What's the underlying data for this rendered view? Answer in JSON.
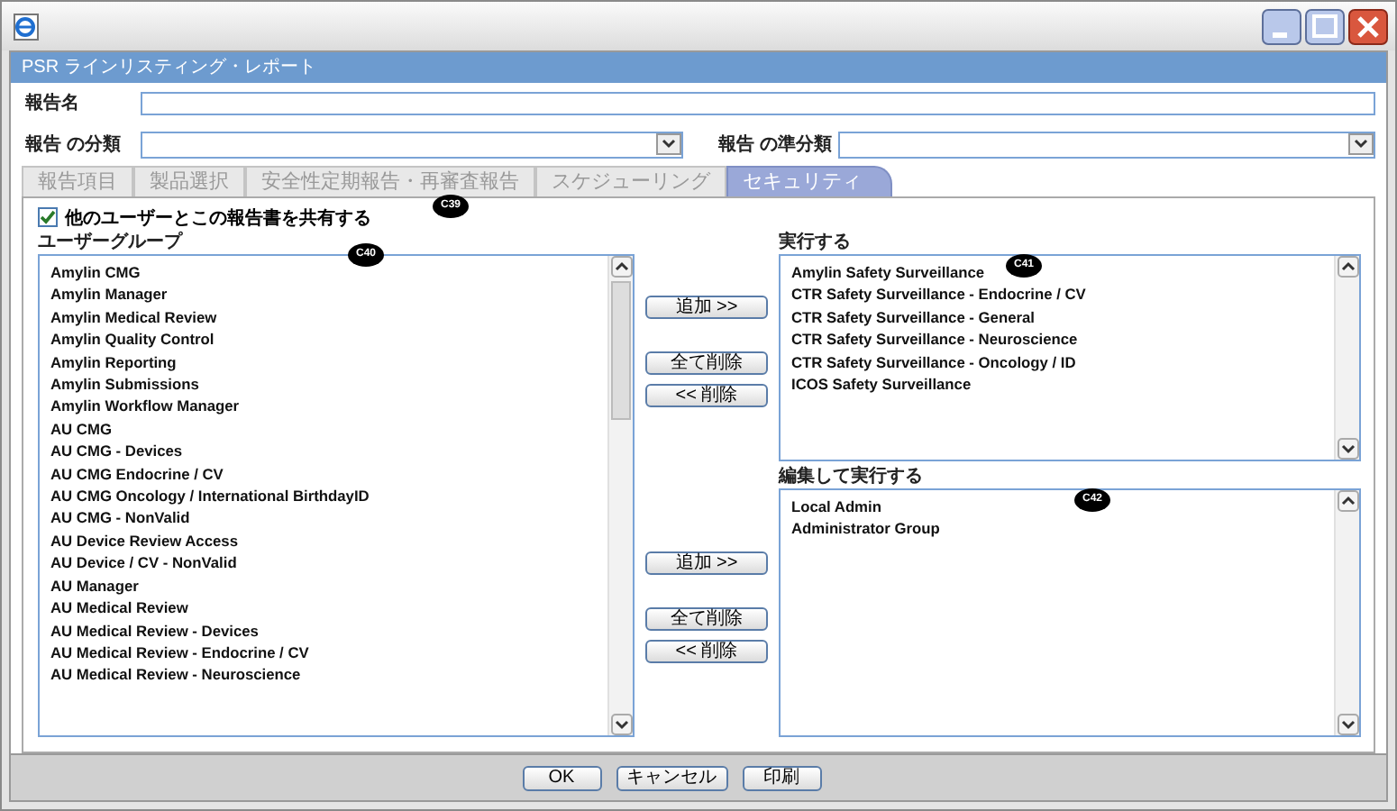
{
  "dialog_header": "PSR ラインリスティング・レポート",
  "fields": [
    {
      "label": "報告名",
      "kind": "text"
    },
    {
      "label": "報告 の分類",
      "kind": "select"
    },
    {
      "label": "報告 の準分類",
      "kind": "select"
    }
  ],
  "tabs": [
    {
      "label": "報告項目",
      "selected": false
    },
    {
      "label": "製品選択",
      "selected": false
    },
    {
      "label": "安全性定期報告・再審査報告",
      "selected": false
    },
    {
      "label": "スケジューリング",
      "selected": false
    },
    {
      "label": "セキュリティ",
      "selected": true
    }
  ],
  "tabs_callout": "C39",
  "share_checkbox": {
    "label": "他のユーザーとこの報告書を共有する",
    "checked": true
  },
  "user_groups": {
    "label": "ユーザーグループ",
    "callout": "C40",
    "items": [
      "Amylin CMG",
      "Amylin Manager",
      "Amylin Medical Review",
      "Amylin Quality Control",
      "Amylin Reporting",
      "Amylin Submissions",
      "Amylin Workflow Manager",
      "AU CMG",
      "AU CMG - Devices",
      "AU CMG Endocrine / CV",
      "AU CMG Oncology / International BirthdayID",
      "AU CMG - NonValid",
      "AU Device Review Access",
      "AU Device / CV - NonValid",
      "AU Manager",
      "AU Medical Review",
      "AU Medical Review - Devices",
      "AU Medical Review - Endocrine / CV",
      "AU Medical Review - Neuroscience"
    ]
  },
  "transfer_groups": [
    {
      "buttons": [
        "追加 >>",
        "全て削除",
        "<< 削除"
      ]
    },
    {
      "buttons": [
        "追加 >>",
        "全て削除",
        "<< 削除"
      ]
    }
  ],
  "execute": {
    "label": "実行する",
    "callout": "C41",
    "items": [
      "Amylin Safety Surveillance",
      "CTR Safety Surveillance - Endocrine / CV",
      "CTR Safety Surveillance - General",
      "CTR Safety Surveillance - Neuroscience",
      "CTR Safety Surveillance - Oncology / ID",
      "ICOS Safety Surveillance"
    ]
  },
  "edit_execute": {
    "label": "編集して実行する",
    "callout": "C42",
    "items": [
      "Local Admin",
      "Administrator Group"
    ]
  },
  "footer_buttons": [
    "OK",
    "キャンセル",
    "印刷"
  ]
}
